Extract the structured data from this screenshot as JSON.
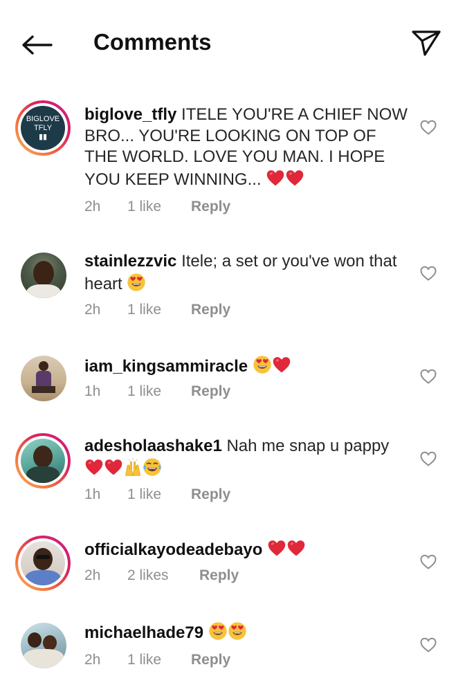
{
  "header": {
    "title": "Comments",
    "back_icon": "arrow-left-icon",
    "share_icon": "paper-plane-icon"
  },
  "comments": [
    {
      "username": "biglove_tfly",
      "text": "ITELE YOU'RE A CHIEF NOW BRO... YOU'RE LOOKING ON TOP OF THE WORLD. LOVE YOU MAN. I HOPE YOU KEEP WINNING...",
      "emojis": [
        "red-heart",
        "red-heart"
      ],
      "avatar_text": [
        "BIGLOVE",
        "TFLY"
      ],
      "time": "2h",
      "likes": "1 like",
      "reply": "Reply"
    },
    {
      "username": "stainlezzvic",
      "text": "Itele; a set or you've won that heart",
      "emojis": [
        "heart-eyes"
      ],
      "time": "2h",
      "likes": "1 like",
      "reply": "Reply"
    },
    {
      "username": "iam_kingsammiracle",
      "text": "",
      "emojis": [
        "heart-eyes",
        "red-heart"
      ],
      "time": "1h",
      "likes": "1 like",
      "reply": "Reply"
    },
    {
      "username": "adesholaashake1",
      "text": "Nah me snap u pappy",
      "emojis": [
        "red-heart",
        "red-heart",
        "raised-hands",
        "tears-of-joy"
      ],
      "time": "1h",
      "likes": "1 like",
      "reply": "Reply"
    },
    {
      "username": "officialkayodeadebayo",
      "text": "",
      "emojis": [
        "red-heart",
        "red-heart"
      ],
      "time": "2h",
      "likes": "2 likes",
      "reply": "Reply"
    },
    {
      "username": "michaelhade79",
      "text": "",
      "emojis": [
        "heart-eyes",
        "heart-eyes"
      ],
      "time": "2h",
      "likes": "1 like",
      "reply": "Reply"
    }
  ],
  "colors": {
    "ring_start": "#fdb55a",
    "ring_end": "#c81d8a",
    "meta_text": "#8e8e8e",
    "heart_emoji": "#e0283b"
  }
}
